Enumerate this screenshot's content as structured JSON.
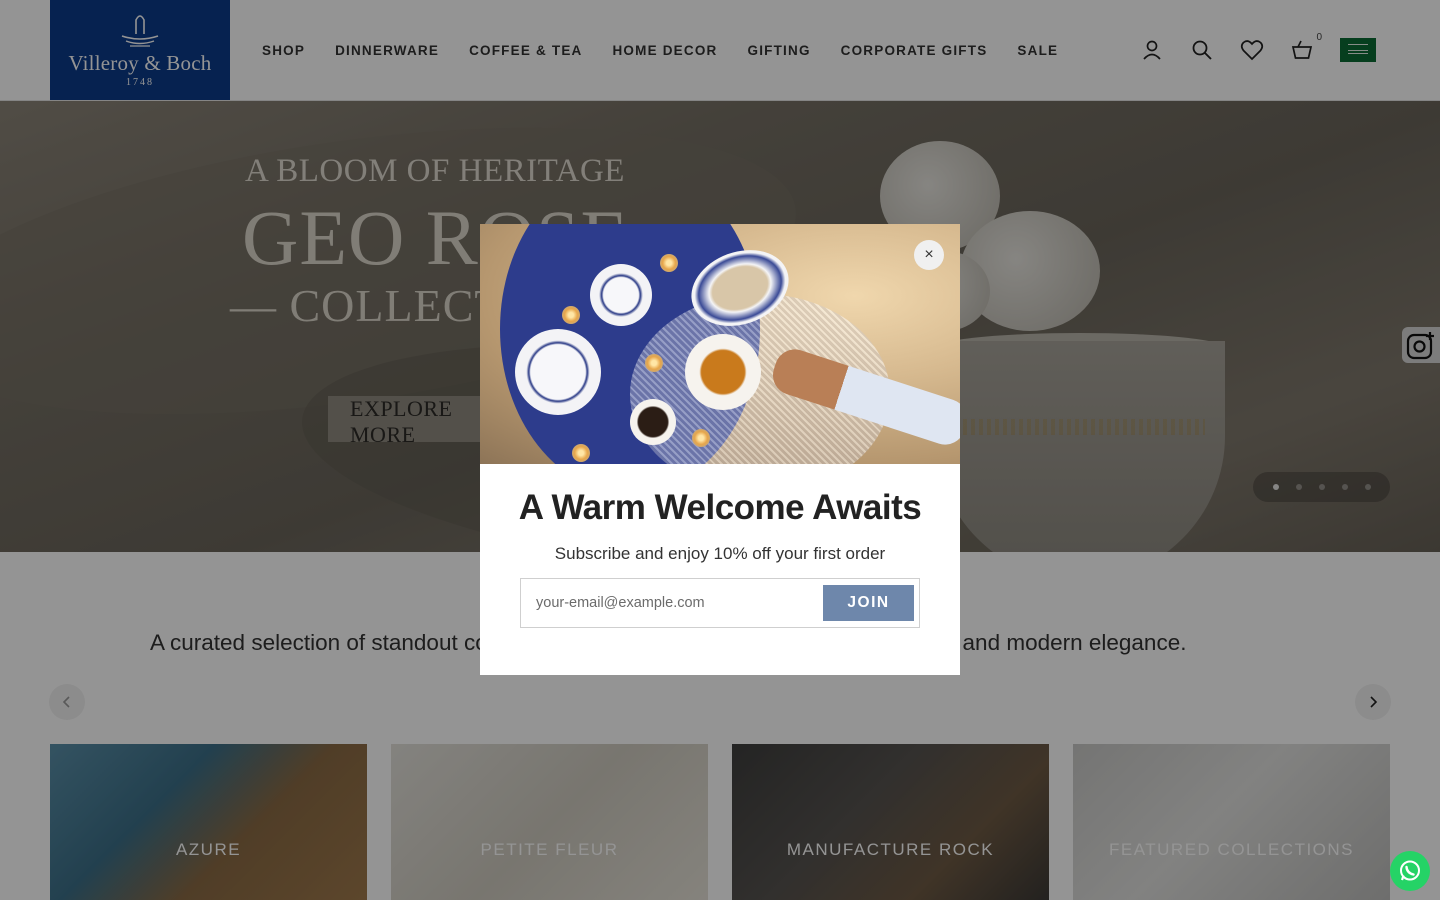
{
  "brand": {
    "name": "Villeroy & Boch",
    "year": "1748"
  },
  "nav": {
    "items": [
      "SHOP",
      "DINNERWARE",
      "COFFEE & TEA",
      "HOME DECOR",
      "GIFTING",
      "CORPORATE GIFTS",
      "SALE"
    ]
  },
  "header_icons": {
    "account": "user-icon",
    "search": "search-icon",
    "wishlist": "heart-icon",
    "cart": "basket-icon",
    "cart_count": "0",
    "region": "saudi-flag-icon"
  },
  "hero": {
    "line1": "A BLOOM OF HERITAGE",
    "line2": "GEO ROSE",
    "line3": "— COLLECTION",
    "cta": "EXPLORE MORE",
    "slides_total": 5,
    "active_slide": 1
  },
  "section": {
    "tagline": "A curated selection of standout collections that blend craftsmanship, functionality, and modern elegance."
  },
  "collections": [
    "AZURE",
    "PETITE FLEUR",
    "MANUFACTURE ROCK",
    "FEATURED COLLECTIONS"
  ],
  "popup": {
    "title": "A Warm Welcome Awaits",
    "subtitle": "Subscribe and enjoy 10% off your first order",
    "email_placeholder": "your-email@example.com",
    "join_label": "JOIN",
    "close_label": "×"
  },
  "colors": {
    "brand_blue": "#0b3b8a",
    "join_button": "#6e87ab",
    "whatsapp": "#25d366",
    "flag_green": "#0b6b34"
  }
}
